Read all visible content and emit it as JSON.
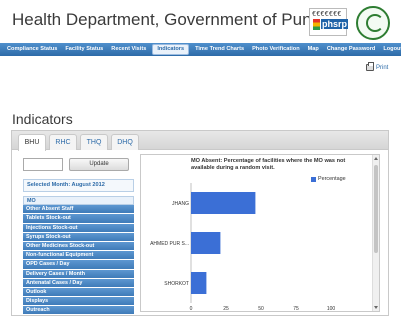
{
  "header": {
    "title": "Health Department, Government of Punjab",
    "logo_text": "phsrp",
    "logo_dots": "€€€€€€€"
  },
  "nav": {
    "items": [
      {
        "label": "Compliance Status"
      },
      {
        "label": "Facility Status"
      },
      {
        "label": "Recent Visits"
      },
      {
        "label": "Indicators",
        "active": true
      },
      {
        "label": "Time Trend Charts"
      },
      {
        "label": "Photo Verification"
      },
      {
        "label": "Map"
      },
      {
        "label": "Change Password"
      },
      {
        "label": "Logout"
      }
    ]
  },
  "print_label": "Print",
  "page_title": "Indicators",
  "tabs": [
    {
      "label": "BHU",
      "active": true
    },
    {
      "label": "RHC"
    },
    {
      "label": "THQ"
    },
    {
      "label": "DHQ"
    }
  ],
  "controls": {
    "month_input_value": "",
    "update_label": "Update",
    "selected_month": "Selected Month: August 2012"
  },
  "indicators": [
    {
      "label": "MO",
      "selected": true
    },
    {
      "label": "Other Absent Staff"
    },
    {
      "label": "Tablets Stock-out"
    },
    {
      "label": "Injections Stock-out"
    },
    {
      "label": "Syrups Stock-out"
    },
    {
      "label": "Other Medicines Stock-out"
    },
    {
      "label": "Non-functional Equipment"
    },
    {
      "label": "OPD Cases / Day"
    },
    {
      "label": "Delivery Cases / Month"
    },
    {
      "label": "Antenatal Cases / Day"
    },
    {
      "label": "Outlook"
    },
    {
      "label": "Displays"
    },
    {
      "label": "Outreach"
    }
  ],
  "colors": {
    "accent": "#2d6ba8",
    "bar": "#3b6fd6"
  },
  "chart_data": {
    "type": "bar",
    "orientation": "horizontal",
    "title": "MO Absent: Percentage of facilities where the MO was not available during a random visit.",
    "categories": [
      "JHANG",
      "AHMED PUR S...",
      "SHORKOT"
    ],
    "series": [
      {
        "name": "Percentage",
        "values": [
          46,
          21,
          11
        ]
      }
    ],
    "xlim": [
      0,
      100
    ],
    "xticks": [
      "0",
      "25",
      "50",
      "75",
      "100"
    ],
    "legend_position": "top-right",
    "grid": false
  }
}
